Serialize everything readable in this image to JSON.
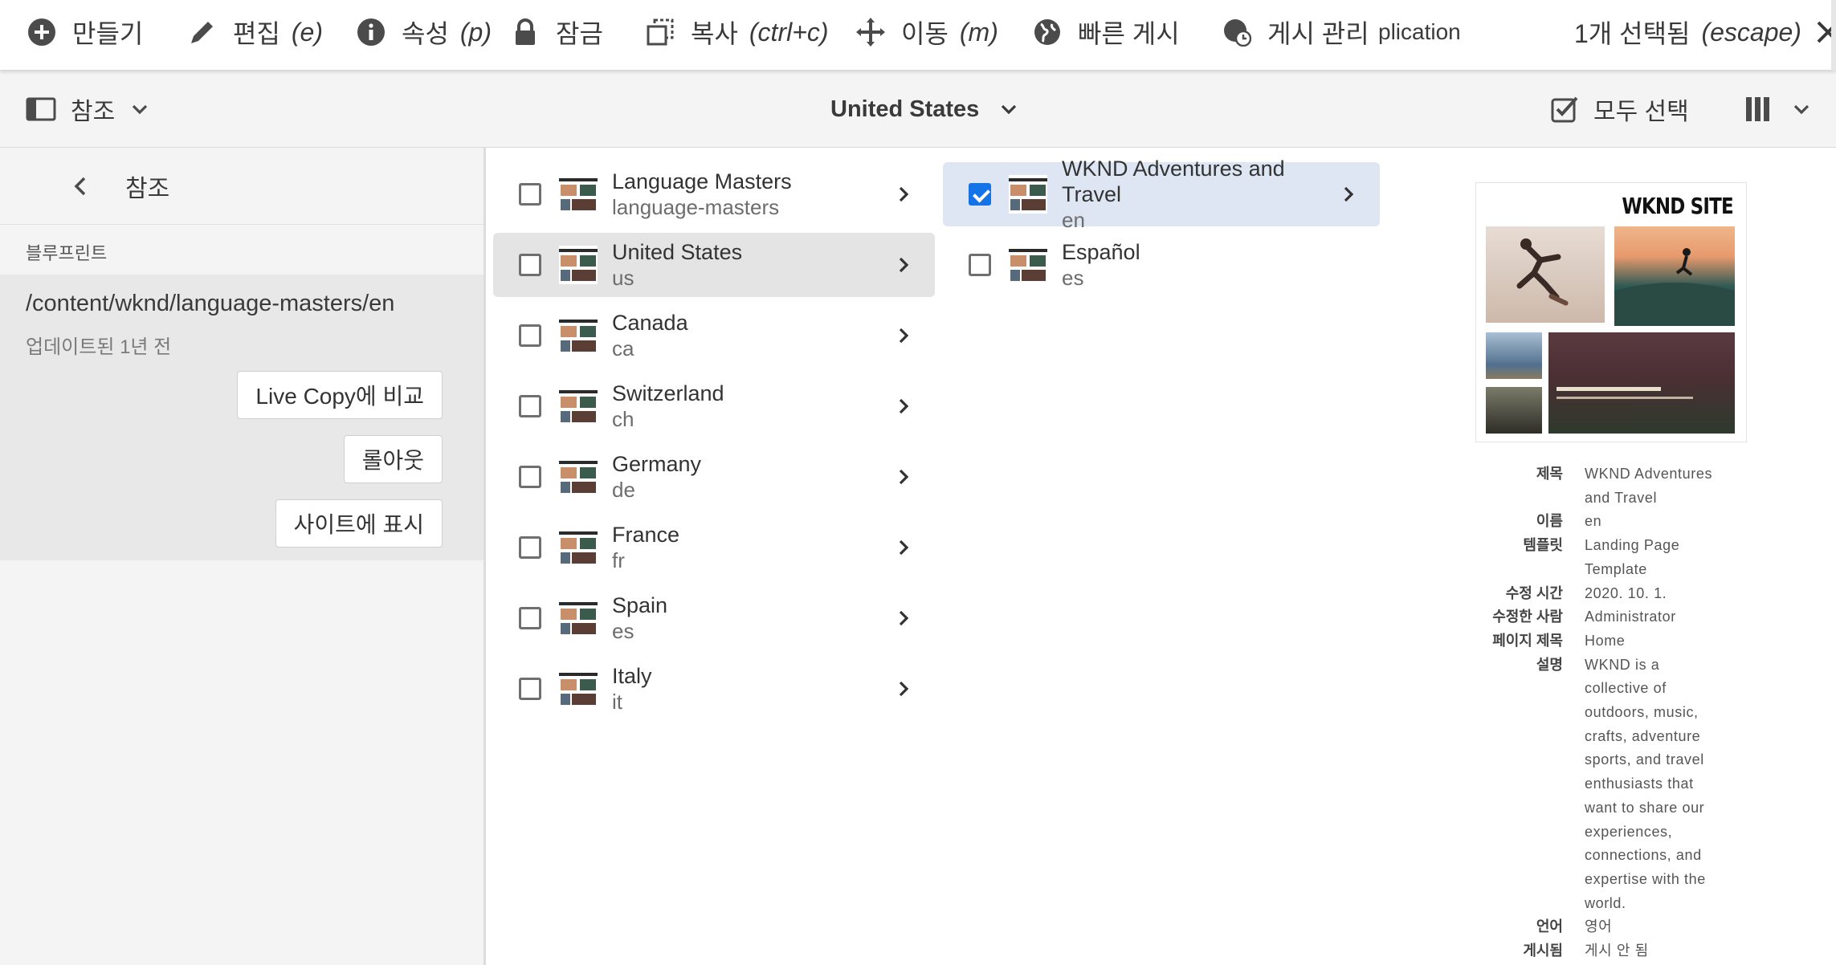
{
  "actionbar": {
    "create": "만들기",
    "edit": "편집",
    "edit_hint": "(e)",
    "properties": "속성",
    "properties_hint": "(p)",
    "lock": "잠금",
    "copy": "복사",
    "copy_hint": "(ctrl+c)",
    "move": "이동",
    "move_hint": "(m)",
    "quick_publish": "빠른 게시",
    "manage_publication": "게시 관리",
    "overflow_text": "plication",
    "selection": "1개 선택됨",
    "selection_hint": "(escape)"
  },
  "toolbar": {
    "rail_label": "참조",
    "title": "United States",
    "select_all": "모두 선택"
  },
  "rail": {
    "header": "참조",
    "section": "블루프린트",
    "path": "/content/wknd/language-masters/en",
    "updated": "업데이트된 1년 전",
    "buttons": [
      "Live Copy에 비교",
      "롤아웃",
      "사이트에 표시"
    ]
  },
  "column1": [
    {
      "title": "Language Masters",
      "name": "language-masters"
    },
    {
      "title": "United States",
      "name": "us"
    },
    {
      "title": "Canada",
      "name": "ca"
    },
    {
      "title": "Switzerland",
      "name": "ch"
    },
    {
      "title": "Germany",
      "name": "de"
    },
    {
      "title": "France",
      "name": "fr"
    },
    {
      "title": "Spain",
      "name": "es"
    },
    {
      "title": "Italy",
      "name": "it"
    }
  ],
  "column2": [
    {
      "title": "WKND Adventures and Travel",
      "name": "en"
    },
    {
      "title": "Español",
      "name": "es"
    }
  ],
  "detail": {
    "preview_logo": "WKND SITE",
    "meta": [
      {
        "key": "제목",
        "lines": [
          "WKND Adventures",
          "and Travel"
        ]
      },
      {
        "key": "이름",
        "lines": [
          "en"
        ]
      },
      {
        "key": "템플릿",
        "lines": [
          "Landing Page",
          "Template"
        ]
      },
      {
        "key": "수정 시간",
        "lines": [
          "2020. 10. 1."
        ]
      },
      {
        "key": "수정한 사람",
        "lines": [
          "Administrator"
        ]
      },
      {
        "key": "페이지 제목",
        "lines": [
          "Home"
        ]
      },
      {
        "key": "설명",
        "lines": [
          "WKND is a",
          "collective of",
          "outdoors, music,",
          "crafts, adventure",
          "sports, and travel",
          "enthusiasts that",
          "want to share our",
          "experiences,",
          "connections, and",
          "expertise with the",
          "world."
        ]
      },
      {
        "key": "언어",
        "lines": [
          "영어"
        ]
      },
      {
        "key": "게시됨",
        "lines": [
          "게시 안 됨"
        ]
      }
    ]
  },
  "colors": {
    "accent": "#1473e6",
    "selected_row": "#dde6f2",
    "highlight_row": "#e4e4e4"
  }
}
